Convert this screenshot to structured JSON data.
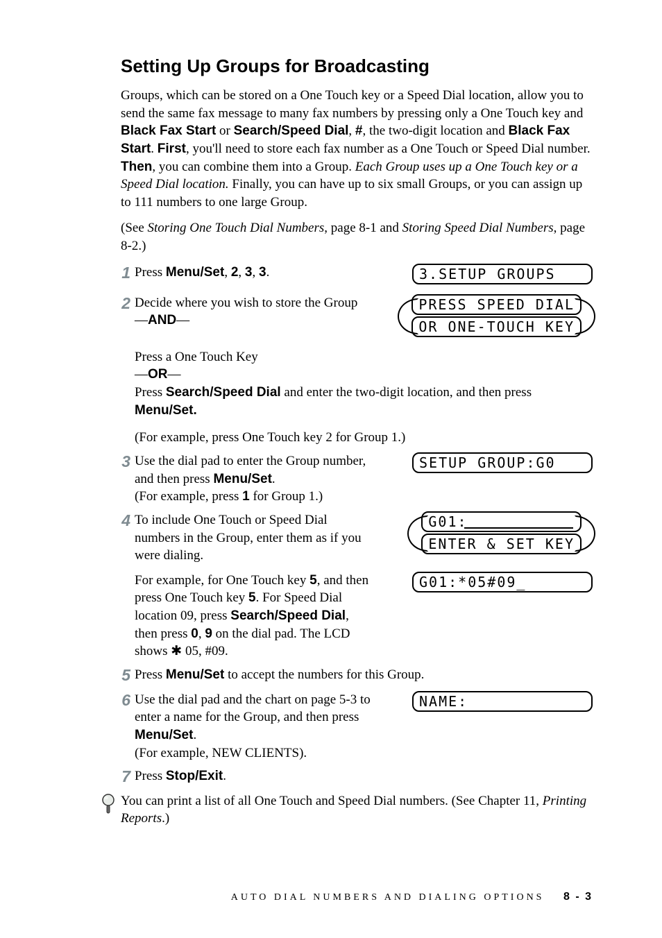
{
  "title": "Setting Up Groups for Broadcasting",
  "intro": {
    "p1a": "Groups, which can be stored on a One Touch key or a Speed Dial location, allow you to send the same fax message to many fax numbers by pressing only a One Touch key and ",
    "b1": "Black Fax Start",
    "p1b": " or ",
    "b2": "Search/Speed Dial",
    "p1c": ", ",
    "b3": "#",
    "p1d": ", the two-digit location and ",
    "b4": "Black Fax Start",
    "p1e": ". ",
    "b5": "First",
    "p1f": ", you'll need to store each fax number as a One Touch or Speed Dial number. ",
    "b6": "Then",
    "p1g": ", you can combine them into a Group. ",
    "i1": "Each Group uses up a One Touch key or a Speed Dial location.",
    "p1h": " Finally, you can have up to six small Groups, or you can assign up to 111 numbers to one large Group."
  },
  "see": {
    "a": "(See ",
    "i1": "Storing One Touch Dial Numbers",
    "b": ", page 8-1 and ",
    "i2": "Storing Speed Dial Numbers",
    "c": ", page 8-2.)"
  },
  "steps": {
    "s1": {
      "num": "1",
      "a": "Press ",
      "b": "Menu/Set",
      "c": ", ",
      "d": "2",
      "e": ", ",
      "f": "3",
      "g": ", ",
      "h": "3",
      "i": "."
    },
    "s2": {
      "num": "2",
      "a": "Decide where you wish to store the Group",
      "and": "AND",
      "p2": "Press a One Touch Key",
      "or": "OR",
      "p3a": "Press ",
      "p3b": "Search/Speed Dial",
      "p3c": " and enter the two-digit location, and then press ",
      "p3d": "Menu/Set.",
      "ex": "(For example, press One Touch key 2 for Group 1.)"
    },
    "s3": {
      "num": "3",
      "a": "Use the dial pad to enter the Group number, and then press ",
      "b": "Menu/Set",
      "c": ".",
      "ex_a": "(For example, press ",
      "ex_b": "1",
      "ex_c": " for Group 1.)"
    },
    "s4": {
      "num": "4",
      "a": "To include One Touch or Speed Dial numbers in the Group, enter them as if you were dialing.",
      "p2a": "For example, for One Touch key ",
      "p2b": "5",
      "p2c": ", and then press One Touch key ",
      "p2d": "5",
      "p2e": ". For Speed Dial location 09, press ",
      "p2f": "Search/Speed Dial",
      "p2g": ", then press ",
      "p2h": "0",
      "p2i": ", ",
      "p2j": "9",
      "p2k": " on the dial pad. The LCD shows ",
      "star": "✱",
      "p2l": " 05, #09."
    },
    "s5": {
      "num": "5",
      "a": "Press ",
      "b": "Menu/Set",
      "c": " to accept the numbers for this Group."
    },
    "s6": {
      "num": "6",
      "a": "Use the dial pad and the chart on page 5-3 to enter a name for the Group, and then press ",
      "b": "Menu/Set",
      "c": ".",
      "ex": "(For example, NEW CLIENTS)."
    },
    "s7": {
      "num": "7",
      "a": "Press ",
      "b": "Stop/Exit",
      "c": "."
    }
  },
  "lcd": {
    "l1": "3.SETUP GROUPS",
    "l2a": "PRESS SPEED DIAL",
    "l2b": "OR ONE-TOUCH KEY",
    "l3": "SETUP GROUP:G0",
    "l4a": "G01:",
    "l4b": "ENTER & SET KEY",
    "l5": "G01:*05#09_",
    "l6": "NAME:"
  },
  "note": {
    "a": "You can print a list of all One Touch and Speed Dial numbers. (See Chapter 11, ",
    "i": "Printing Reports",
    "b": ".)"
  },
  "footer": {
    "section": "AUTO DIAL NUMBERS AND DIALING OPTIONS",
    "page": "8 - 3"
  }
}
